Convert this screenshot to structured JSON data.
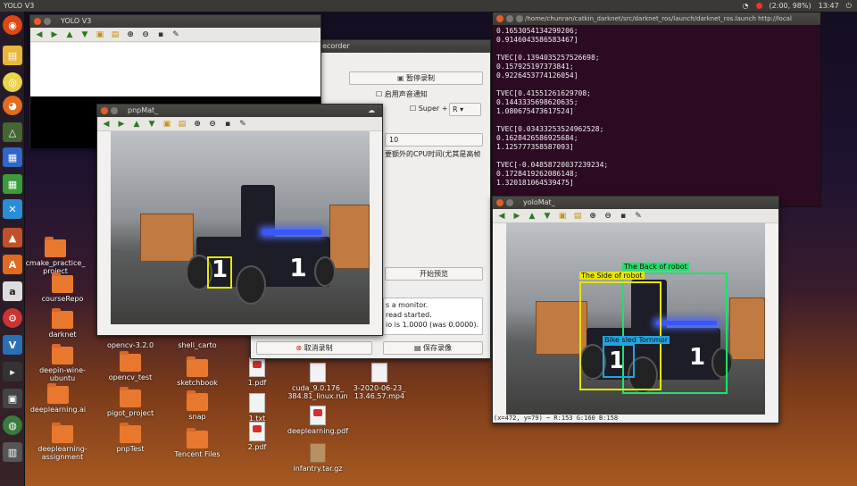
{
  "topbar": {
    "title": "YOLO V3",
    "time": "13:47",
    "battery": "(2:00, 98%)"
  },
  "desktop": {
    "icons": [
      {
        "label": "cmake_practice_\nproject",
        "kind": "folder"
      },
      {
        "label": "courseRepo",
        "kind": "folder"
      },
      {
        "label": "darknet",
        "kind": "folder"
      },
      {
        "label": "opencv-3.2.0",
        "kind": "folder"
      },
      {
        "label": "shell_carto",
        "kind": "folder"
      },
      {
        "label": "deepin-wine-\nubuntu",
        "kind": "folder"
      },
      {
        "label": "opencv_test",
        "kind": "folder"
      },
      {
        "label": "sketchbook",
        "kind": "folder"
      },
      {
        "label": "1.pdf",
        "kind": "pdf"
      },
      {
        "label": "cuda_9.0.176_\n384.81_linux.run",
        "kind": "file"
      },
      {
        "label": "3-2020-06-23_\n13.46.57.mp4",
        "kind": "file"
      },
      {
        "label": "deeplearning.ai",
        "kind": "folder"
      },
      {
        "label": "pigot_project",
        "kind": "folder"
      },
      {
        "label": "snap",
        "kind": "folder"
      },
      {
        "label": "1.txt",
        "kind": "file"
      },
      {
        "label": "deeplearning-\nassignment",
        "kind": "folder"
      },
      {
        "label": "pnpTest",
        "kind": "folder"
      },
      {
        "label": "Tencent Files",
        "kind": "folder"
      },
      {
        "label": "2.pdf",
        "kind": "pdf"
      },
      {
        "label": "deeplearning.pdf",
        "kind": "pdf"
      },
      {
        "label": "infantry.tar.gz",
        "kind": "pkg"
      }
    ]
  },
  "yolo_window": {
    "title": "YOLO V3"
  },
  "pnp_window": {
    "title": "pnpMat_"
  },
  "yolomat_window": {
    "title": "yoloMat_",
    "status": "(x=472, y=79) ~ R:153 G:160 B:158",
    "boxes": [
      {
        "label": "The Back of robot"
      },
      {
        "label": "The Side of robot"
      },
      {
        "label": "Bike sled Tornmor"
      }
    ]
  },
  "recorder": {
    "title": "ecorder",
    "pause_btn": "暂停录制",
    "audio_check": "启用声音通知",
    "super_label": "Super +",
    "super_key": "R",
    "fps_value": "10",
    "cpu_note": "要额外的CPU时间(尤其是高帧",
    "preview_btn": "开始预览",
    "log": [
      "s a monitor.",
      "read started.",
      "io is 1.0000 (was 0.0000)."
    ],
    "cancel_btn": "取消录制",
    "save_btn": "保存录像"
  },
  "terminal": {
    "title": "/home/chunran/catkin_darknet/src/darknet_ros/launch/darknet_ros.launch http://local",
    "lines": [
      "0.1653054134299206;",
      "0.9146043586583467]",
      "",
      "TVEC[0.1394035257526698;",
      "0.157925197373841;",
      "0.9226453774126054]",
      "",
      "TVEC[0.41551261629708;",
      "0.1443335698620635;",
      "1.080675473617524]",
      "",
      "TVEC[0.03433253524962528;",
      "0.1628426586925684;",
      "1.125777358587093]",
      "",
      "TVEC[-0.04858720037239234;",
      "0.1728419262086148;",
      "1.320181064539475]"
    ]
  }
}
